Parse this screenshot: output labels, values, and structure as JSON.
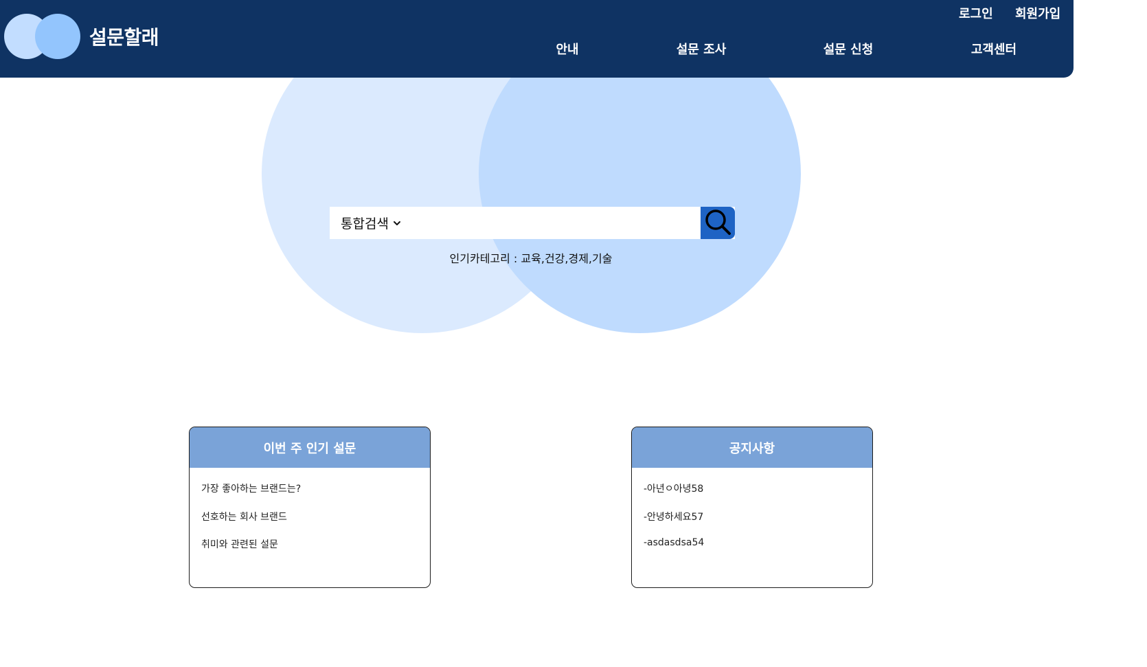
{
  "colors": {
    "header_bg": "#0f3363",
    "logo_circle_1": "#c2ddff",
    "logo_circle_2": "#93c5fd",
    "hero_circle_1": "#dbeafe",
    "hero_circle_2": "#bfdbfe",
    "search_button": "#1e63c4",
    "card_header": "#7aa3d8"
  },
  "header": {
    "logo_text": "설문할래",
    "login": "로그인",
    "signup": "회원가입",
    "nav": [
      "안내",
      "설문 조사",
      "설문 신청",
      "고객센터"
    ]
  },
  "search": {
    "category_selected": "통합검색",
    "placeholder": "",
    "value": "",
    "popular_label": "인기카테고리 : ",
    "popular_categories": "교육,건강,경제,기술",
    "icons": {
      "dropdown": "chevron-down-icon",
      "submit": "search-icon"
    }
  },
  "cards": [
    {
      "title": "이번 주 인기 설문",
      "items": [
        "가장 좋아하는 브랜드는?",
        "선호하는 회사 브랜드",
        "취미와 관련된 설문"
      ]
    },
    {
      "title": "공지사항",
      "items": [
        "-아년ㅇ아녕58",
        "-안녕하세요57",
        "-asdasdsa54"
      ]
    }
  ]
}
